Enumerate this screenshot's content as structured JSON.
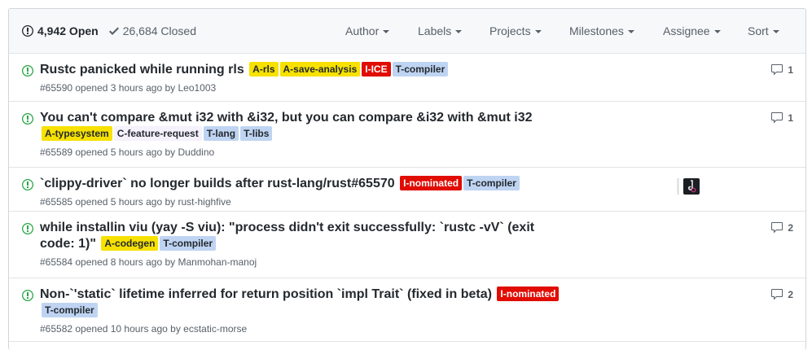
{
  "header": {
    "open_count": "4,942 Open",
    "closed_count": "26,684 Closed",
    "filters": [
      {
        "label": "Author"
      },
      {
        "label": "Labels"
      },
      {
        "label": "Projects"
      },
      {
        "label": "Milestones"
      },
      {
        "label": "Assignee"
      },
      {
        "label": "Sort"
      }
    ]
  },
  "colors": {
    "open_green": "#28a745",
    "muted": "#586069",
    "border": "#e1e4e8"
  },
  "issues": [
    {
      "title": "Rustc panicked while running rls",
      "labels": [
        {
          "text": "A-rls",
          "bg": "#f7e101",
          "fg": "#24292e"
        },
        {
          "text": "A-save-analysis",
          "bg": "#f7e101",
          "fg": "#24292e"
        },
        {
          "text": "I-ICE",
          "bg": "#e10c02",
          "fg": "#ffffff"
        },
        {
          "text": "T-compiler",
          "bg": "#bfd4f2",
          "fg": "#24292e"
        }
      ],
      "meta": "#65590 opened 3 hours ago by Leo1003",
      "comments": "1"
    },
    {
      "title": "You can't compare &mut i32 with &i32, but you can compare &i32 with &mut i32",
      "labels": [
        {
          "text": "A-typesystem",
          "bg": "#f7e101",
          "fg": "#24292e"
        },
        {
          "text": "C-feature-request",
          "bg": "#f5f1fd",
          "fg": "#24292e"
        },
        {
          "text": "T-lang",
          "bg": "#bfd4f2",
          "fg": "#24292e"
        },
        {
          "text": "T-libs",
          "bg": "#bfd4f2",
          "fg": "#24292e"
        }
      ],
      "meta": "#65589 opened 5 hours ago by Duddino",
      "comments": "1"
    },
    {
      "title": "`clippy-driver` no longer builds after rust-lang/rust#65570",
      "labels": [
        {
          "text": "I-nominated",
          "bg": "#e10c02",
          "fg": "#ffffff"
        },
        {
          "text": "T-compiler",
          "bg": "#bfd4f2",
          "fg": "#24292e"
        }
      ],
      "meta": "#65585 opened 5 hours ago by rust-highfive",
      "comments": ""
    },
    {
      "title": "while installin viu (yay -S viu): \"process didn't exit successfully: `rustc -vV` (exit code: 1)\"",
      "labels": [
        {
          "text": "A-codegen",
          "bg": "#f7e101",
          "fg": "#24292e"
        },
        {
          "text": "T-compiler",
          "bg": "#bfd4f2",
          "fg": "#24292e"
        }
      ],
      "meta": "#65584 opened 8 hours ago by Manmohan-manoj",
      "comments": "2"
    },
    {
      "title": "Non-`'static` lifetime inferred for return position `impl Trait` (fixed in beta)",
      "labels": [
        {
          "text": "I-nominated",
          "bg": "#e10c02",
          "fg": "#ffffff"
        },
        {
          "text": "T-compiler",
          "bg": "#bfd4f2",
          "fg": "#24292e"
        }
      ],
      "meta": "#65582 opened 10 hours ago by ecstatic-morse",
      "comments": "2"
    }
  ]
}
